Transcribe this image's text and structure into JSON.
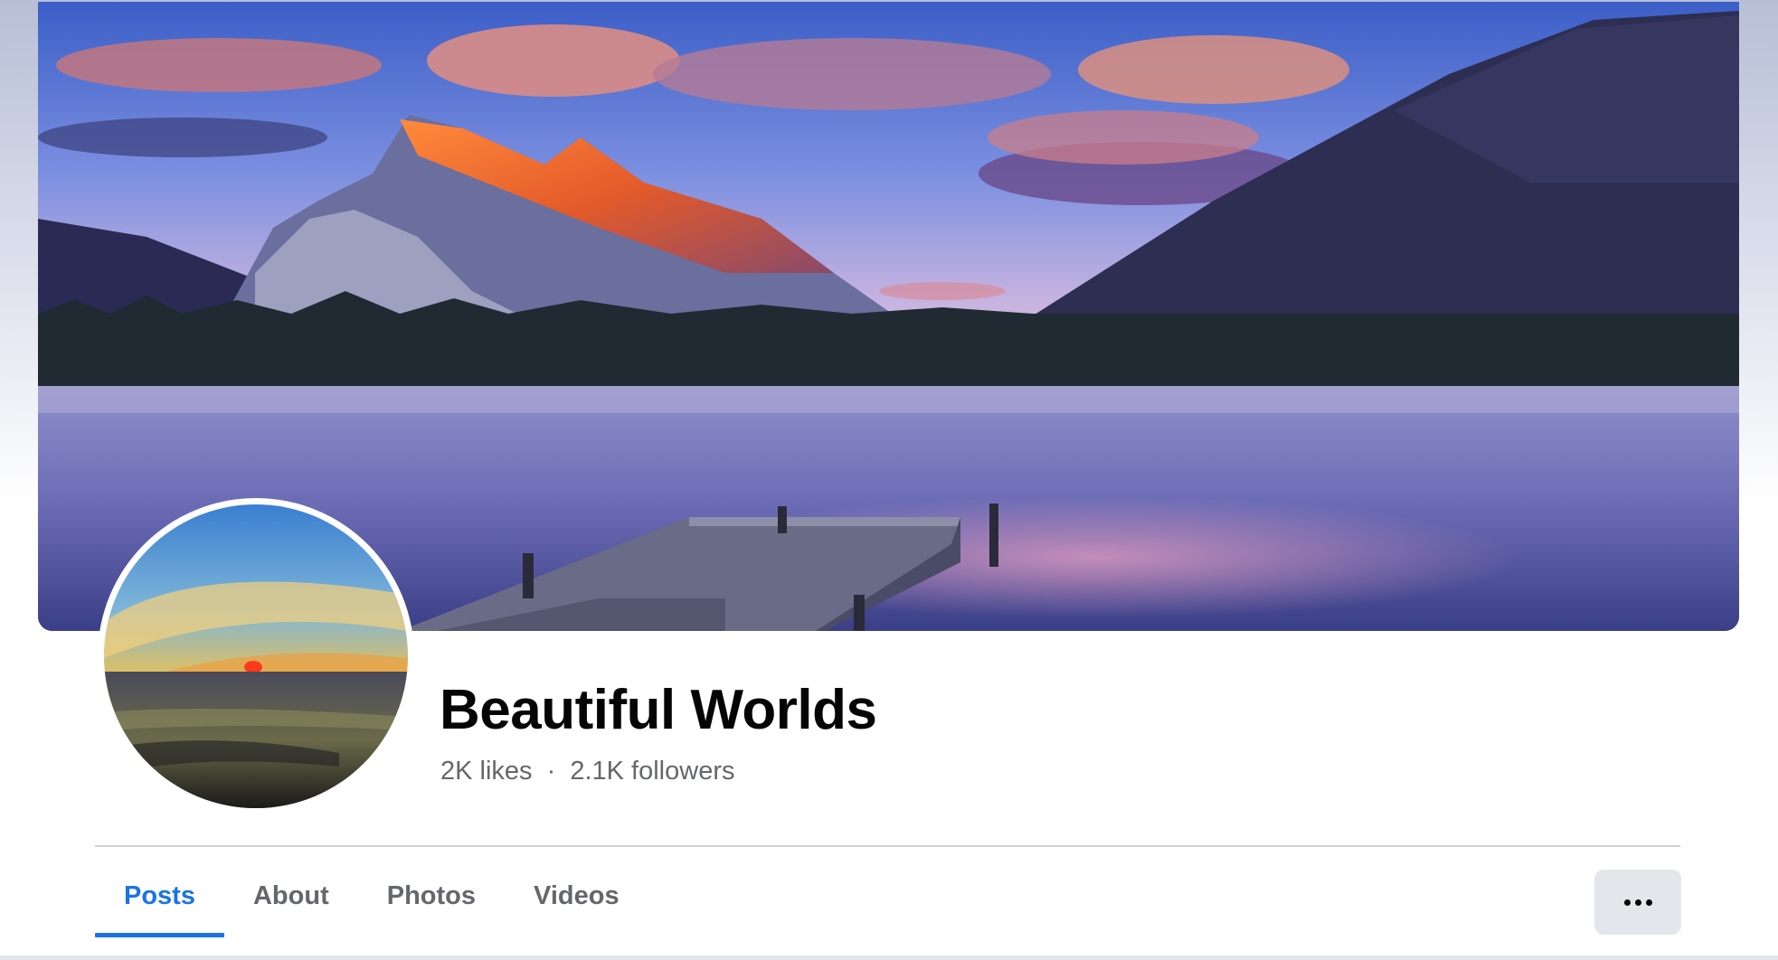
{
  "page": {
    "title": "Beautiful Worlds",
    "likes": "2K likes",
    "separator": "·",
    "followers": "2.1K followers"
  },
  "cover": {
    "description_icon": "cover-photo"
  },
  "avatar": {
    "icon": "profile-picture"
  },
  "tabs": [
    {
      "label": "Posts",
      "active": true
    },
    {
      "label": "About",
      "active": false
    },
    {
      "label": "Photos",
      "active": false
    },
    {
      "label": "Videos",
      "active": false
    }
  ],
  "more_button": {
    "icon": "more-horizontal-icon"
  },
  "colors": {
    "accent": "#1b74e4",
    "text_primary": "#050505",
    "text_secondary": "#65676b",
    "button_bg": "#e4e6eb"
  }
}
